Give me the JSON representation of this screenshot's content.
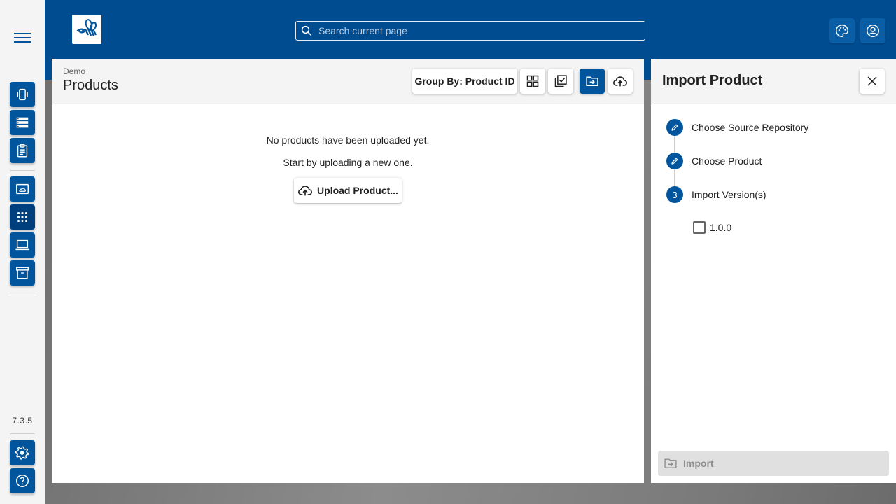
{
  "app": {
    "version": "7.3.5",
    "logo_name": "bee-logo"
  },
  "header": {
    "search_placeholder": "Search current page",
    "search_value": "",
    "actions": [
      {
        "name": "theme-palette",
        "icon": "palette-icon"
      },
      {
        "name": "user-account",
        "icon": "account-circle-icon"
      }
    ]
  },
  "rail": {
    "top_groups": [
      [
        {
          "name": "devices",
          "icon": "vibration-icon"
        },
        {
          "name": "servers",
          "icon": "storage-icon"
        },
        {
          "name": "clipboard",
          "icon": "clipboard-icon"
        }
      ],
      [
        {
          "name": "cloud-image",
          "icon": "cloud-frame-icon"
        },
        {
          "name": "apps",
          "icon": "apps-grid-icon",
          "active": true
        },
        {
          "name": "laptop",
          "icon": "laptop-icon"
        },
        {
          "name": "archive",
          "icon": "archive-icon"
        }
      ]
    ],
    "bottom": [
      {
        "name": "settings",
        "icon": "gear-icon"
      },
      {
        "name": "help",
        "icon": "help-icon"
      }
    ]
  },
  "main": {
    "breadcrumb": "Demo",
    "title": "Products",
    "toolbar": {
      "group_by_label": "Group By: Product ID",
      "buttons": [
        {
          "name": "grid-view",
          "icon": "grid-icon"
        },
        {
          "name": "multi-select",
          "icon": "library-check-icon"
        },
        {
          "name": "import-product",
          "icon": "folder-import-icon",
          "active": true
        },
        {
          "name": "upload",
          "icon": "cloud-upload-icon"
        }
      ]
    },
    "empty_state": {
      "line1": "No products have been uploaded yet.",
      "line2": "Start by uploading a new one.",
      "upload_label": "Upload Product..."
    }
  },
  "side_panel": {
    "title": "Import Product",
    "steps": [
      {
        "label": "Choose Source Repository",
        "state": "edit"
      },
      {
        "label": "Choose Product",
        "state": "edit"
      },
      {
        "label": "Import Version(s)",
        "state": "current",
        "number": "3"
      }
    ],
    "versions": [
      {
        "label": "1.0.0",
        "checked": false
      }
    ],
    "import_label": "Import",
    "import_enabled": false
  },
  "colors": {
    "brand": "#004c91",
    "button": "#00559c",
    "disabled_bg": "#e0e0e0"
  }
}
